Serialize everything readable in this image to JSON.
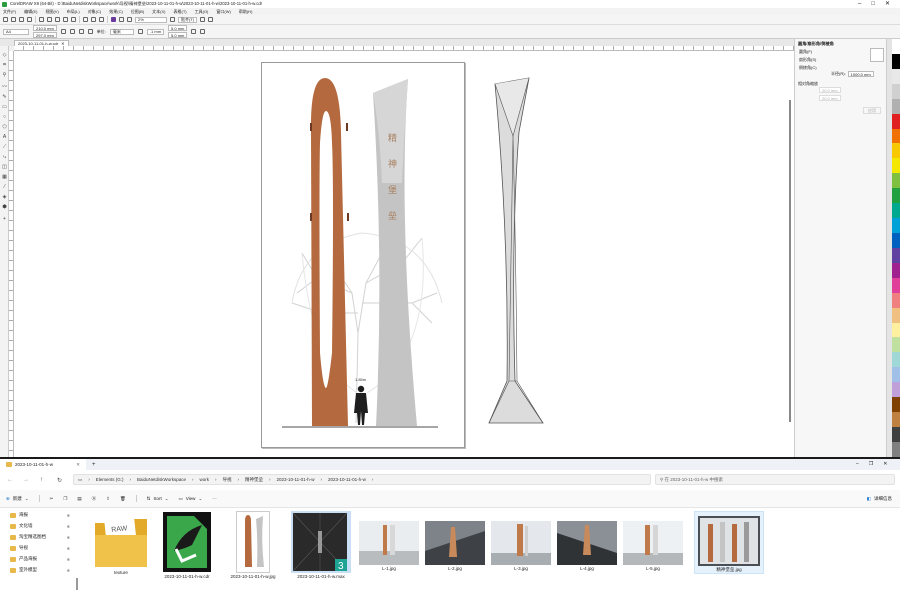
{
  "coreldraw": {
    "title": "CorelDRAW X8 (64-Bit) - D:\\BaiduNetdiskWorkspace\\work\\导视\\精神堡垒\\2023-10-11-01-h-w\\2023-10-11-01-h-w\\2023-10-11-01-h-w.cdr",
    "menu": [
      "文件(F)",
      "编辑(E)",
      "视图(V)",
      "布局(L)",
      "对象(C)",
      "效果(C)",
      "位图(B)",
      "文本(X)",
      "表格(T)",
      "工具(O)",
      "窗口(W)",
      "帮助(H)"
    ],
    "zoom": "2%",
    "snap_label": "贴齐(T)",
    "page_size": "A4",
    "width": "210.0 mm",
    "height": "297.0 mm",
    "units_label": "单位:",
    "units_value": "毫米",
    "nudge": ".1 mm",
    "dup_x": "5.0 mm",
    "dup_y": "5.0 mm",
    "doc_tab": "2023-10-11-01-h-w.cdr",
    "side_label": "1.85m",
    "panel": {
      "title": "圆角/扇形角/倒棱角",
      "options": [
        "圆角(F)",
        "扇形角(S)",
        "倒棱角(C)"
      ],
      "radius_label": "半径(R):",
      "radius_value": "1000.0 mm",
      "prop_label": "相对角缩放",
      "field1": "20.0 mm",
      "field2": "20.0 mm",
      "apply": "应用"
    },
    "colors": [
      "#ffffff",
      "#000000",
      "#e8e8e8",
      "#d0d0d0",
      "#b0b0b0",
      "#e02020",
      "#f07000",
      "#f8c800",
      "#f4e800",
      "#80c040",
      "#20a040",
      "#00a890",
      "#00a0d8",
      "#0060c0",
      "#6040a0",
      "#a02090",
      "#e0409a",
      "#f08080",
      "#f0c080",
      "#fff0a0",
      "#c0e0a0",
      "#a0d8d8",
      "#a0c0e8",
      "#c0a0d8",
      "#804000",
      "#c08040",
      "#404040",
      "#808080"
    ]
  },
  "explorer": {
    "tab_title": "2023-10-11-01-h-w",
    "breadcrumb": [
      "Elements (G:)",
      "BaiduNetdiskWorkspace",
      "work",
      "导视",
      "精神堡垒",
      "2023-10-11-01-h-w",
      "2023-10-11-01-h-w"
    ],
    "search_placeholder": "在 2023-10-11-01-h-w 中搜索",
    "new_label": "新建",
    "sort_label": "Sort",
    "view_label": "View",
    "details_label": "详细信息",
    "sidebar": [
      "海报",
      "文化墙",
      "淘宝精选图档",
      "导视",
      "产品海报",
      "室外模型"
    ],
    "files": [
      {
        "name": "texture",
        "kind": "folder"
      },
      {
        "name": "2023-10-11-01-h-w.cdr",
        "kind": "cdr"
      },
      {
        "name": "2023-10-11-01-h-w.jpg",
        "kind": "jpg"
      },
      {
        "name": "2023-10-11-01-h-w.max",
        "kind": "max",
        "badge": "3"
      },
      {
        "name": "L-1.jpg",
        "kind": "render"
      },
      {
        "name": "L-2.jpg",
        "kind": "render"
      },
      {
        "name": "L-3.jpg",
        "kind": "render"
      },
      {
        "name": "L-4.jpg",
        "kind": "render"
      },
      {
        "name": "L-5.jpg",
        "kind": "render"
      },
      {
        "name": "精神堡垒.jpg",
        "kind": "jpg"
      }
    ]
  }
}
